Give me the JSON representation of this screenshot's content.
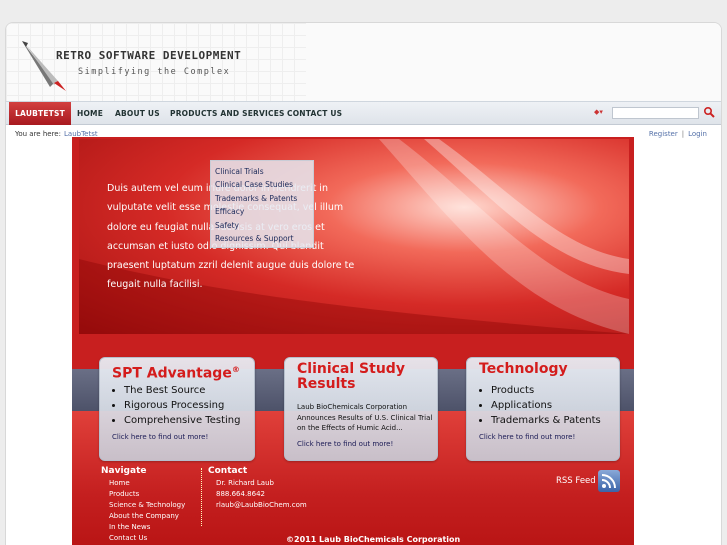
{
  "brand": {
    "title": "RETRO SOFTWARE DEVELOPMENT",
    "subtitle": "Simplifying the Complex"
  },
  "nav": {
    "items": [
      "LAUBTETST",
      "HOME",
      "ABOUT US",
      "PRODUCTS AND SERVICES",
      "CONTACT US"
    ]
  },
  "breadcrumb": {
    "label": "You are here:",
    "current": "LaubTetst"
  },
  "account": {
    "register": "Register",
    "separator": "|",
    "login": "Login"
  },
  "hero": {
    "text": "Duis autem vel eum iriure dolor in hendrerit in vulputate velit esse molestie consequat, vel illum dolore eu feugiat nulla facilisis at vero eros et accumsan et iusto odio dignissim. Qui blandit praesent luptatum zzril delenit augue duis dolore te feugait nulla facilisi."
  },
  "dropdown": {
    "items": [
      "Clinical Trials",
      "Clinical Case Studies",
      "Trademarks & Patents",
      "Efficacy",
      "Safety",
      "Resources & Support"
    ]
  },
  "cards": [
    {
      "title": "SPT Advantage",
      "sup": "®",
      "bullets": [
        "The Best Source",
        "Rigorous Processing",
        "Comprehensive Testing"
      ],
      "link": "Click here to find out more!"
    },
    {
      "title": "Clinical Study Results",
      "body": "Laub BioChemicals Corporation Announces Results of U.S. Clinical Trial on the Effects of Humic Acid...",
      "link": "Click here to find out more!"
    },
    {
      "title": "Technology",
      "bullets": [
        "Products",
        "Applications",
        "Trademarks & Patents"
      ],
      "link": "Click here to find out more!"
    }
  ],
  "footer": {
    "navigate_title": "Navigate",
    "navigate_items": [
      "Home",
      "Products",
      "Science & Technology",
      "About the Company",
      "In the News",
      "Contact Us"
    ],
    "contact_title": "Contact",
    "contact_lines": [
      "Dr. Richard Laub",
      "888.664.8642",
      "rlaub@LaubBioChem.com"
    ],
    "rss": "RSS Feed",
    "copyright": "©2011 Laub BioChemicals Corporation"
  },
  "colors": {
    "accent": "#d41c1c",
    "nav_active": "#b8252a",
    "link": "#5470a8"
  },
  "icons": {
    "search": "search-icon",
    "rss": "rss-icon",
    "logo": "rocket-logo-icon"
  }
}
